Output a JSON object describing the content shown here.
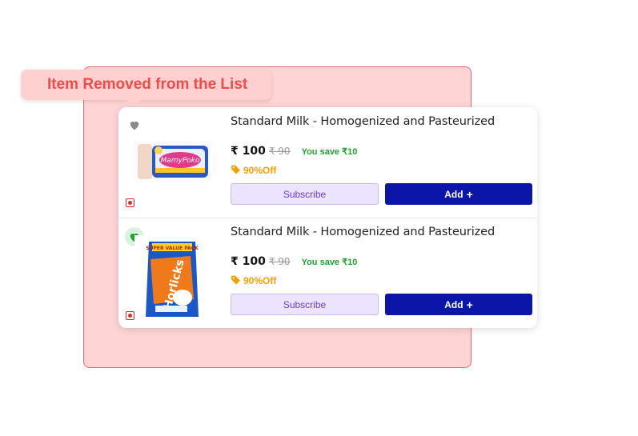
{
  "toast": {
    "message": "Item Removed from the List"
  },
  "products": [
    {
      "title": "Standard Milk - Homogenized and Pasteurized",
      "price": "₹ 100",
      "mrp": "₹ 90",
      "savings": "You save ₹10",
      "discount": "90%Off",
      "subscribe_label": "Subscribe",
      "add_label": "Add",
      "favorited": false,
      "image": "diaper-pack-image"
    },
    {
      "title": "Standard Milk - Homogenized and Pasteurized",
      "price": "₹ 100",
      "mrp": "₹ 90",
      "savings": "You save ₹10",
      "discount": "90%Off",
      "subscribe_label": "Subscribe",
      "add_label": "Add",
      "favorited": true,
      "image": "horlicks-pack-image"
    }
  ],
  "colors": {
    "accent_blue": "#0b16a8",
    "subscribe_bg": "#ece3ff",
    "save_green": "#1ea32e",
    "discount_orange": "#f5a000",
    "toast_red": "#f04a4a",
    "backdrop_pink": "#ffd4d4"
  }
}
